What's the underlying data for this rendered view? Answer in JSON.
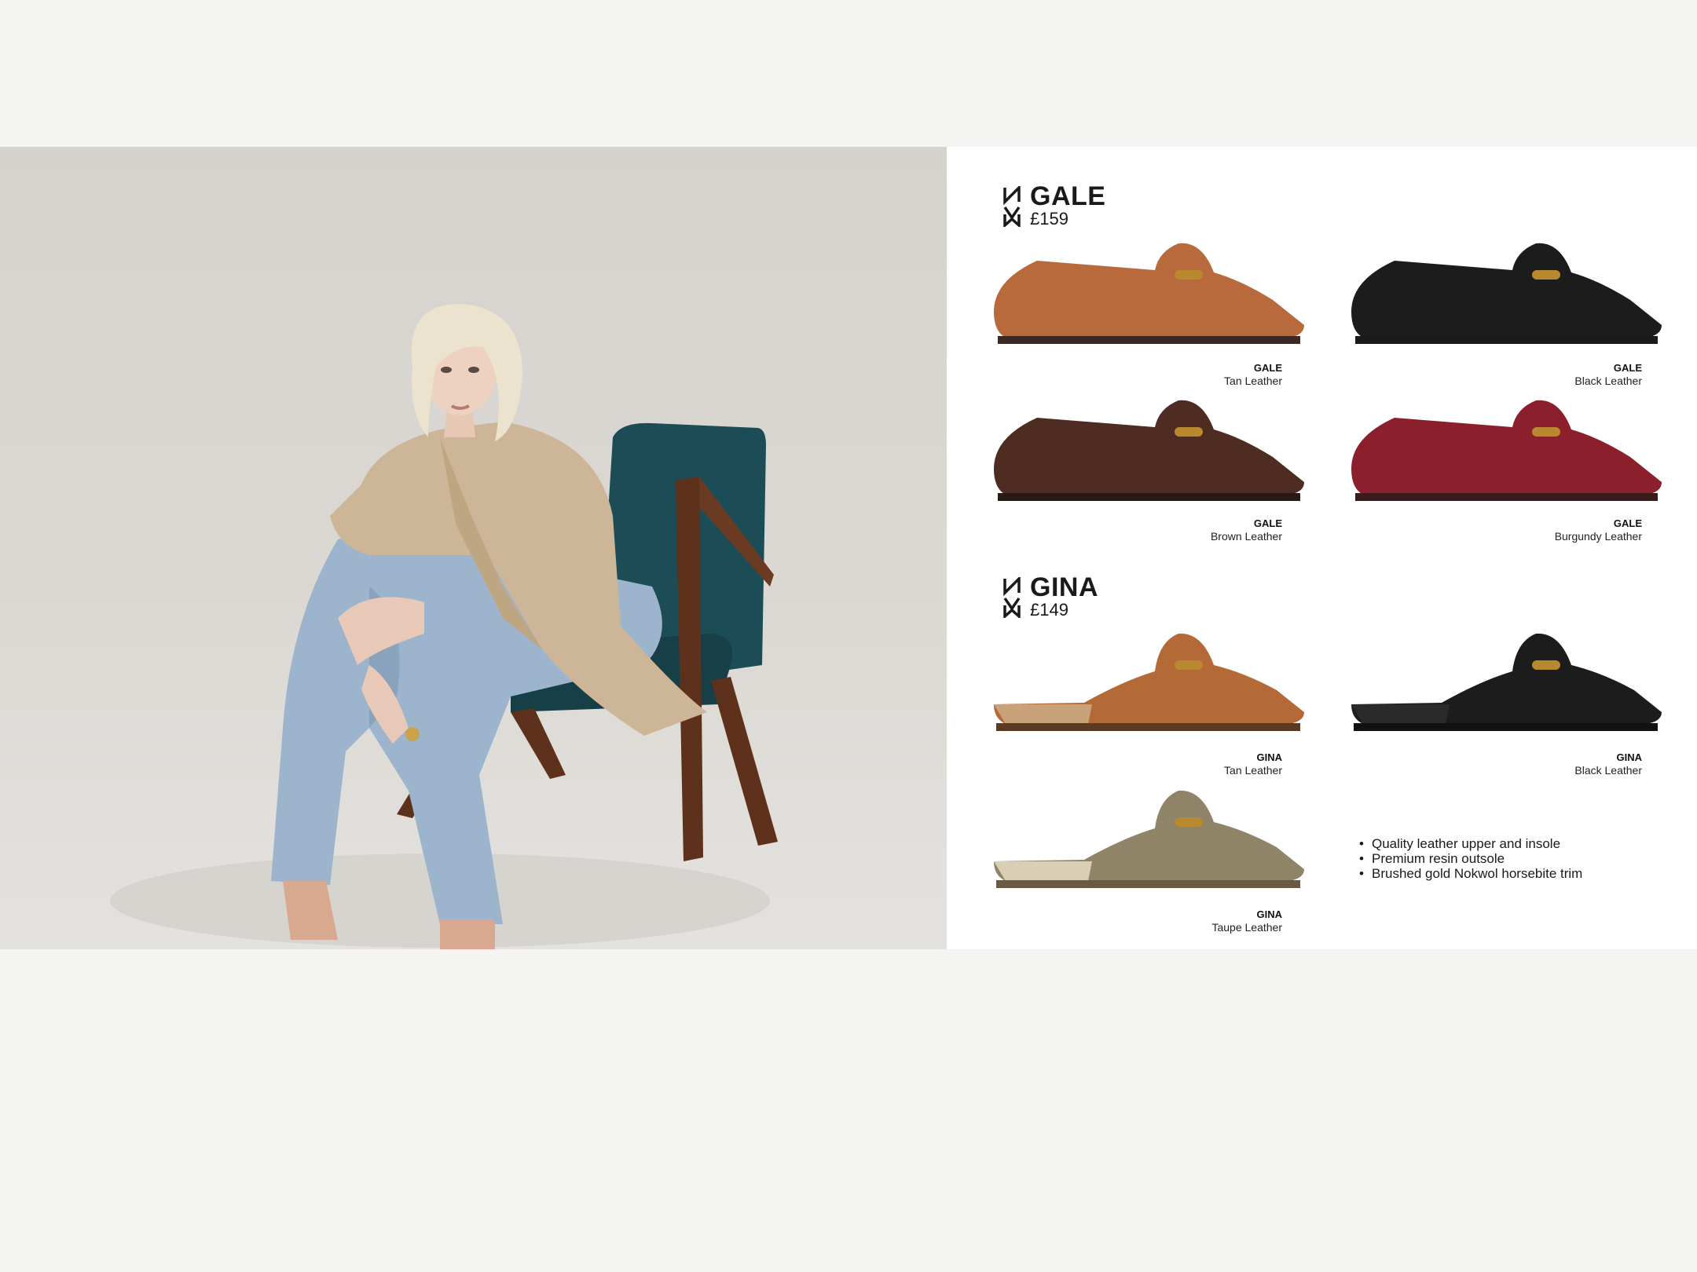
{
  "photo": {
    "alt": "Model seated in a teal armchair wearing tan loafers"
  },
  "sections": [
    {
      "name": "GALE",
      "price": "£159"
    },
    {
      "name": "GINA",
      "price": "£149"
    }
  ],
  "products": [
    {
      "model": "GALE",
      "color": "Tan Leather",
      "fill": "#b86a3c"
    },
    {
      "model": "GALE",
      "color": "Black Leather",
      "fill": "#1c1c1c"
    },
    {
      "model": "GALE",
      "color": "Brown Leather",
      "fill": "#4e2c22"
    },
    {
      "model": "GALE",
      "color": "Burgundy Leather",
      "fill": "#8c1f2c"
    },
    {
      "model": "GINA",
      "color": "Tan Leather",
      "fill": "#b36a37"
    },
    {
      "model": "GINA",
      "color": "Black Leather",
      "fill": "#1c1c1c"
    },
    {
      "model": "GINA",
      "color": "Taupe Leather",
      "fill": "#8f8468"
    }
  ],
  "features": [
    "Quality leather upper and insole",
    "Premium resin outsole",
    "Brushed gold Nokwol horsebite trim"
  ],
  "colors": {
    "page_bg": "#f4f4f3",
    "panel_bg": "#ffffff",
    "text": "#1a1a1a",
    "hardware_gold": "#b8892e"
  }
}
